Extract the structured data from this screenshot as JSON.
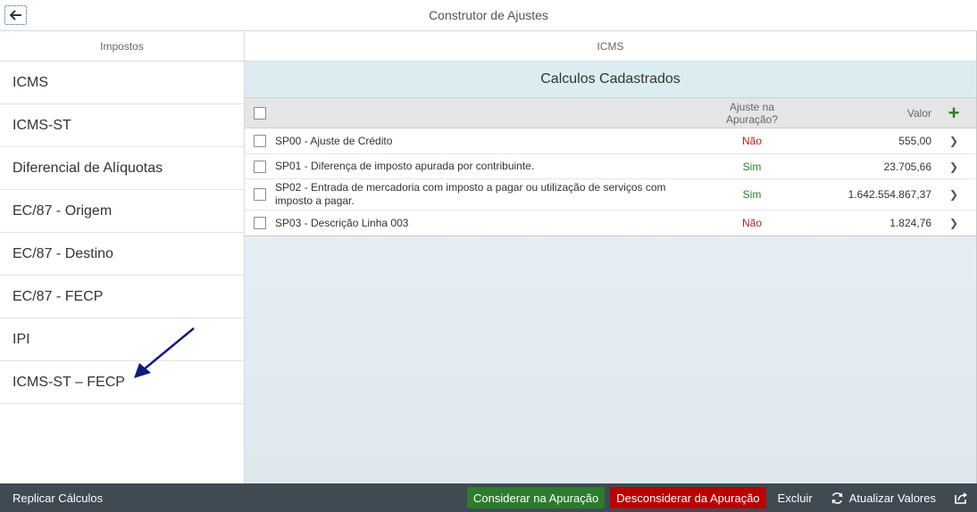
{
  "header": {
    "title": "Construtor de Ajustes",
    "back_icon": "arrow-left-icon"
  },
  "master": {
    "title": "Impostos",
    "items": [
      {
        "label": "ICMS"
      },
      {
        "label": "ICMS-ST"
      },
      {
        "label": "Diferencial de Alíquotas"
      },
      {
        "label": "EC/87 - Origem"
      },
      {
        "label": "EC/87 - Destino"
      },
      {
        "label": "EC/87 - FECP"
      },
      {
        "label": "IPI"
      },
      {
        "label": "ICMS-ST – FECP"
      }
    ]
  },
  "detail": {
    "title": "ICMS",
    "table_title": "Calculos Cadastrados",
    "columns": {
      "ajuste_line1": "Ajuste na",
      "ajuste_line2": "Apuração?",
      "valor": "Valor"
    },
    "add_label": "+",
    "rows": [
      {
        "desc": "SP00 - Ajuste de Crédito",
        "ajuste": "Não",
        "valor": "555,00"
      },
      {
        "desc": "SP01 - Diferença de imposto apurada por contribuinte.",
        "ajuste": "Sim",
        "valor": "23.705,66"
      },
      {
        "desc": "SP02 - Entrada de mercadoria com imposto a pagar ou utilização de serviços com imposto a pagar.",
        "ajuste": "Sim",
        "valor": "1.642.554.867,37"
      },
      {
        "desc": "SP03 - Descrição Linha 003",
        "ajuste": "Não",
        "valor": "1.824,76"
      }
    ],
    "nav_glyph": "❯"
  },
  "footer": {
    "replicar": "Replicar Cálculos",
    "considerar": "Considerar na Apuração",
    "desconsiderar": "Desconsiderar da Apuração",
    "excluir": "Excluir",
    "atualizar": "Atualizar Valores"
  },
  "colors": {
    "accent_green": "#2b7c2b",
    "accent_red": "#bb0000",
    "footer_bg": "#3f4a52",
    "annotation_arrow": "#0d1a80"
  }
}
